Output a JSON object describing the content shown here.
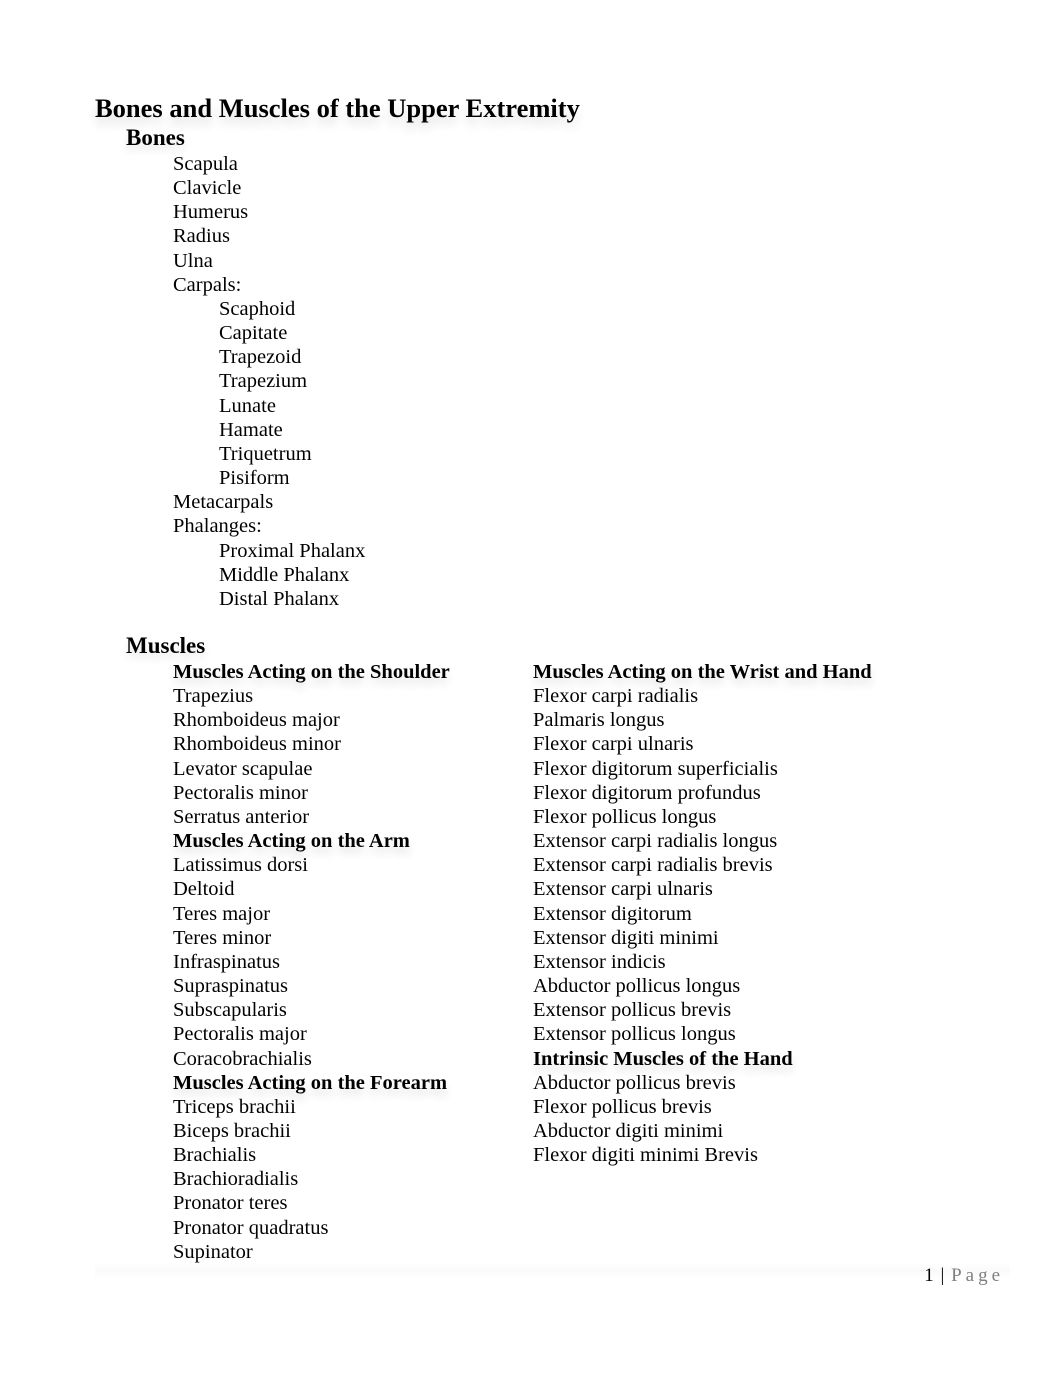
{
  "document": {
    "title": "Bones and Muscles of the Upper Extremity",
    "bones": {
      "heading": "Bones",
      "items": [
        {
          "label": "Scapula",
          "level": 1
        },
        {
          "label": "Clavicle",
          "level": 1
        },
        {
          "label": "Humerus",
          "level": 1
        },
        {
          "label": "Radius",
          "level": 1
        },
        {
          "label": "Ulna",
          "level": 1
        },
        {
          "label": "Carpals:",
          "level": 1
        },
        {
          "label": "Scaphoid",
          "level": 2
        },
        {
          "label": "Capitate",
          "level": 2
        },
        {
          "label": "Trapezoid",
          "level": 2
        },
        {
          "label": "Trapezium",
          "level": 2
        },
        {
          "label": "Lunate",
          "level": 2
        },
        {
          "label": "Hamate",
          "level": 2
        },
        {
          "label": "Triquetrum",
          "level": 2
        },
        {
          "label": "Pisiform",
          "level": 2
        },
        {
          "label": "Metacarpals",
          "level": 1
        },
        {
          "label": "Phalanges:",
          "level": 1
        },
        {
          "label": "Proximal Phalanx",
          "level": 2
        },
        {
          "label": "Middle Phalanx",
          "level": 2
        },
        {
          "label": "Distal Phalanx",
          "level": 2
        }
      ]
    },
    "muscles": {
      "heading": "Muscles",
      "left_column": [
        {
          "heading": "Muscles Acting on the Shoulder",
          "items": [
            "Trapezius",
            "Rhomboideus major",
            "Rhomboideus minor",
            "Levator scapulae",
            "Pectoralis minor",
            "Serratus anterior"
          ]
        },
        {
          "heading": "Muscles Acting on the Arm",
          "items": [
            "Latissimus dorsi",
            "Deltoid",
            "Teres major",
            "Teres minor",
            "Infraspinatus",
            "Supraspinatus",
            "Subscapularis",
            "Pectoralis major",
            "Coracobrachialis"
          ]
        },
        {
          "heading": "Muscles Acting on the Forearm",
          "items": [
            "Triceps brachii",
            "Biceps brachii",
            "Brachialis",
            "Brachioradialis",
            "Pronator teres",
            "Pronator quadratus",
            "Supinator"
          ]
        }
      ],
      "right_column": [
        {
          "heading": "Muscles Acting on the Wrist and Hand",
          "items": [
            "Flexor carpi radialis",
            "Palmaris longus",
            "Flexor carpi ulnaris",
            "Flexor digitorum superficialis",
            "Flexor digitorum profundus",
            "Flexor pollicus longus",
            "Extensor carpi radialis longus",
            "Extensor carpi radialis brevis",
            "Extensor carpi ulnaris",
            "Extensor digitorum",
            "Extensor digiti minimi",
            "Extensor indicis",
            "Abductor pollicus longus",
            "Extensor pollicus brevis",
            "Extensor pollicus longus"
          ]
        },
        {
          "heading": "Intrinsic Muscles of the Hand",
          "items": [
            "Abductor pollicus brevis",
            "Flexor pollicus brevis",
            "Abductor digiti minimi",
            "Flexor digiti minimi Brevis"
          ]
        }
      ]
    },
    "footer": {
      "page_number": "1",
      "separator": "|",
      "page_label": "Page"
    }
  }
}
